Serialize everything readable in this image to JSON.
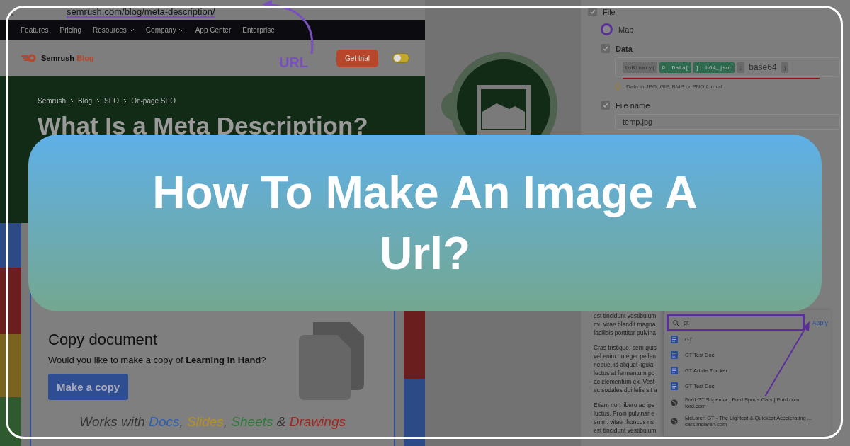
{
  "browser": {
    "url": "semrush.com/blog/meta-description/"
  },
  "nav": {
    "items": [
      {
        "label": "Features",
        "dropdown": false
      },
      {
        "label": "Pricing",
        "dropdown": false
      },
      {
        "label": "Resources",
        "dropdown": true
      },
      {
        "label": "Company",
        "dropdown": true
      },
      {
        "label": "App Center",
        "dropdown": false
      },
      {
        "label": "Enterprise",
        "dropdown": false
      }
    ]
  },
  "blog_header": {
    "brand": "Semrush",
    "brand_suffix": "Blog",
    "annotation": "URL",
    "cta": "Get trial",
    "toggle_on": false
  },
  "hero": {
    "breadcrumb": [
      "Semrush",
      "Blog",
      "SEO",
      "On-page SEO"
    ],
    "title": "What Is a Meta Description?"
  },
  "copy_card": {
    "title": "Copy document",
    "prompt": "Would you like to make a copy of **Learning in Hand**?",
    "button": "Make a copy",
    "works_with": [
      {
        "text": "Works with ",
        "color": "#333333"
      },
      {
        "text": "Docs",
        "color": "#2c5fb0"
      },
      {
        "text": ", ",
        "color": "#333333"
      },
      {
        "text": "Slides",
        "color": "#b8921e"
      },
      {
        "text": ", ",
        "color": "#333333"
      },
      {
        "text": "Sheets",
        "color": "#2f7a3a"
      },
      {
        "text": " & ",
        "color": "#333333"
      },
      {
        "text": "Drawings",
        "color": "#a3251f"
      }
    ]
  },
  "settings": {
    "file": {
      "label": "File",
      "checked": true
    },
    "map": {
      "label": "Map",
      "selected": true
    },
    "data": {
      "label": "Data",
      "checked": true,
      "formula": [
        {
          "text": "toBinary(",
          "kind": "function"
        },
        {
          "text": "9. Data[",
          "kind": "variable"
        },
        {
          "text": "]: b64_json",
          "kind": "variable"
        },
        {
          "text": ";",
          "kind": "function"
        },
        {
          "text": "base64",
          "kind": "plain"
        },
        {
          "text": ")",
          "kind": "function"
        }
      ],
      "hint": "Data in JPG, GIF, BMP or PNG format"
    },
    "file_name": {
      "label": "File name",
      "checked": true,
      "value": "temp.jpg"
    }
  },
  "document": {
    "paragraphs": [
      [
        "est tincidunt vestibulum",
        "mi, vitae blandit magna",
        "facilisis porttitor pulvina"
      ],
      [
        "Cras tristique, sem quis",
        "vel enim. Integer pellen",
        "neque, id aliquet ligula",
        "lectus at fermentum po",
        "ac elementum ex. Vest",
        "ac sodales dui felis sit a"
      ],
      [
        "Etiam non libero ac ips",
        "luctus. Proin pulvinar e",
        "enim. vitae rhoncus ris",
        "est tincidunt vestibulum"
      ]
    ]
  },
  "link_popup": {
    "query": "gt",
    "apply": "Apply",
    "results": [
      {
        "kind": "doc",
        "title": "GT"
      },
      {
        "kind": "doc",
        "title": "GT Test Doc"
      },
      {
        "kind": "doc",
        "title": "GT Article Tracker"
      },
      {
        "kind": "doc",
        "title": "GT Test Doc"
      },
      {
        "kind": "web",
        "title": "Ford GT Supercar | Ford Sports Cars | Ford.com",
        "url": "ford.com"
      },
      {
        "kind": "web",
        "title": "McLaren GT - The Lightest & Quickest Accelerating ...",
        "url": "cars.mclaren.com"
      }
    ]
  },
  "banner": {
    "title": "How To Make An Image A Url?"
  }
}
